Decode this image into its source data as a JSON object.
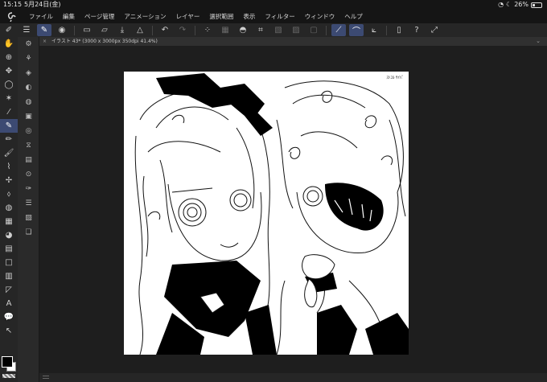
{
  "status_bar": {
    "time": "15:15",
    "date": "5月24日(金)",
    "battery": "26%"
  },
  "menubar": {
    "items": [
      "ファイル",
      "編集",
      "ページ管理",
      "アニメーション",
      "レイヤー",
      "選択範囲",
      "表示",
      "フィルター",
      "ウィンドウ",
      "ヘルプ"
    ]
  },
  "document": {
    "tab_title": "イラスト 43* (3000 x 3000px 350dpi 41.4%)",
    "signature": "ｽﾄﾕﾙ ｻｲﾊﾟ"
  },
  "colors": {
    "accent": "#3c4a72",
    "main_color": "#000000",
    "sub_color": "#ffffff"
  }
}
